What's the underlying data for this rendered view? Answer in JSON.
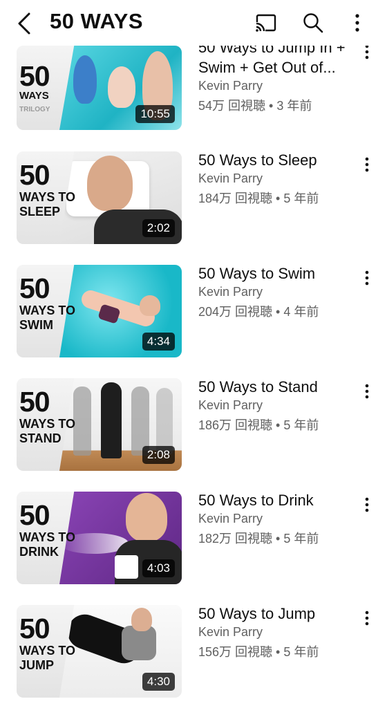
{
  "header": {
    "title": "50 WAYS"
  },
  "videos": [
    {
      "title": "50 Ways to Jump In + Swim + Get Out of...",
      "channel": "Kevin Parry",
      "meta": "54万 回視聴 • 3 年前",
      "duration": "10:55",
      "thumb_big": "50",
      "thumb_sub": "WAYS",
      "thumb_sub2": "TRILOGY",
      "theme": "#41c9d6"
    },
    {
      "title": "50 Ways to Sleep",
      "channel": "Kevin Parry",
      "meta": "184万 回視聴 • 5 年前",
      "duration": "2:02",
      "thumb_big": "50",
      "thumb_sub": "WAYS TO SLEEP",
      "theme": "#e8e8e8"
    },
    {
      "title": "50 Ways to Swim",
      "channel": "Kevin Parry",
      "meta": "204万 回視聴 • 4 年前",
      "duration": "4:34",
      "thumb_big": "50",
      "thumb_sub": "WAYS TO SWIM",
      "theme": "#2fc6d3"
    },
    {
      "title": "50 Ways to Stand",
      "channel": "Kevin Parry",
      "meta": "186万 回視聴 • 5 年前",
      "duration": "2:08",
      "thumb_big": "50",
      "thumb_sub": "WAYS TO STAND",
      "theme": "#f3f3f3"
    },
    {
      "title": "50 Ways to Drink",
      "channel": "Kevin Parry",
      "meta": "182万 回視聴 • 5 年前",
      "duration": "4:03",
      "thumb_big": "50",
      "thumb_sub": "WAYS TO DRINK",
      "theme": "#7a3aa0"
    },
    {
      "title": "50 Ways to Jump",
      "channel": "Kevin Parry",
      "meta": "156万 回視聴 • 5 年前",
      "duration": "4:30",
      "thumb_big": "50",
      "thumb_sub": "WAYS TO JUMP",
      "theme": "#f6f6f6"
    }
  ]
}
